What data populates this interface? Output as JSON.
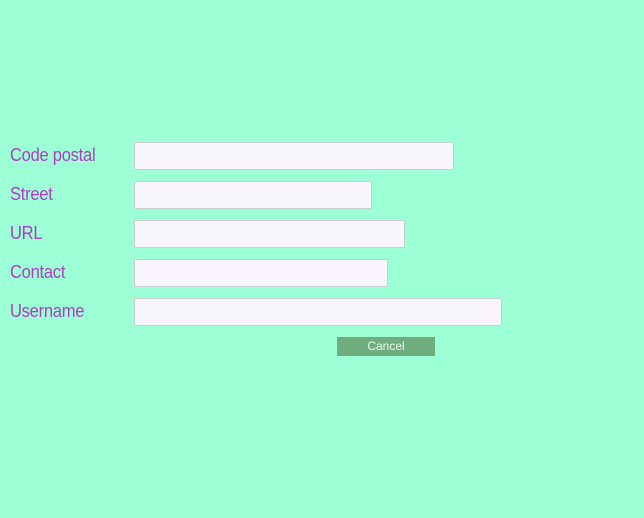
{
  "form": {
    "fields": [
      {
        "label": "Code postal",
        "value": "",
        "placeholder": ""
      },
      {
        "label": "Street",
        "value": "",
        "placeholder": ""
      },
      {
        "label": "URL",
        "value": "",
        "placeholder": ""
      },
      {
        "label": "Contact",
        "value": "",
        "placeholder": ""
      },
      {
        "label": "Username",
        "value": "",
        "placeholder": ""
      }
    ],
    "cancel_label": "Cancel"
  },
  "colors": {
    "background": "#9dffd6",
    "label_text": "#b03cbf",
    "input_background": "#f8f6fc",
    "button_background": "#6fad7d",
    "button_text": "#eef7ef"
  }
}
